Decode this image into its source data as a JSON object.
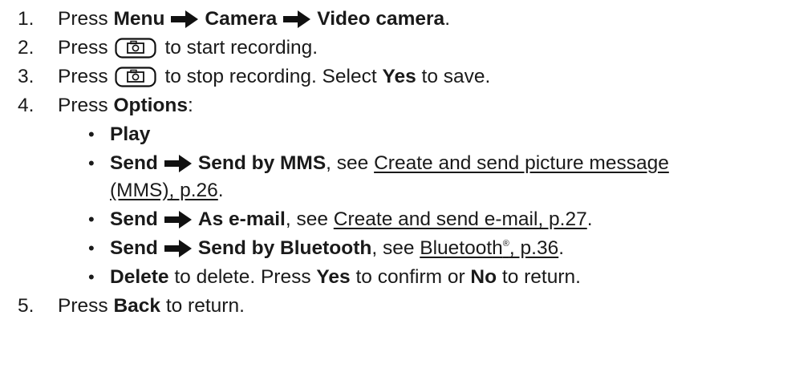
{
  "steps": [
    {
      "num": "1.",
      "press": "Press ",
      "menu": "Menu",
      "camera": "Camera",
      "video": "Video camera",
      "end": "."
    },
    {
      "num": "2.",
      "press": "Press",
      "rest": " to start recording."
    },
    {
      "num": "3.",
      "press": "Press",
      "rest": " to stop recording. Select ",
      "yes": "Yes",
      "end": " to save."
    },
    {
      "num": "4.",
      "press": "Press ",
      "options": "Options",
      "end": ":"
    },
    {
      "num": "5.",
      "press": "Press ",
      "back": "Back",
      "end": " to return."
    }
  ],
  "options": [
    {
      "bullet": "•",
      "label": "Play"
    },
    {
      "bullet": "•",
      "label": "Send",
      "target": "Send by MMS",
      "see": ", see ",
      "link": "Create and send picture message",
      "link2": "(MMS), p.26",
      "end": "."
    },
    {
      "bullet": "•",
      "label": "Send",
      "target": "As e-mail",
      "see": ", see ",
      "link": "Create and send e-mail, p.27",
      "end": "."
    },
    {
      "bullet": "•",
      "label": "Send",
      "target": "Send by Bluetooth",
      "see": ", see ",
      "link": "Bluetooth",
      "reg": "®",
      "link_tail": ", p.36",
      "end": "."
    },
    {
      "bullet": "•",
      "label": "Delete",
      "rest1": " to delete. Press ",
      "yes": "Yes",
      "rest2": " to confirm or ",
      "no": "No",
      "rest3": " to return."
    }
  ],
  "icons": {
    "arrow": "right-arrow-icon",
    "camera_key": "camera-key-icon"
  }
}
